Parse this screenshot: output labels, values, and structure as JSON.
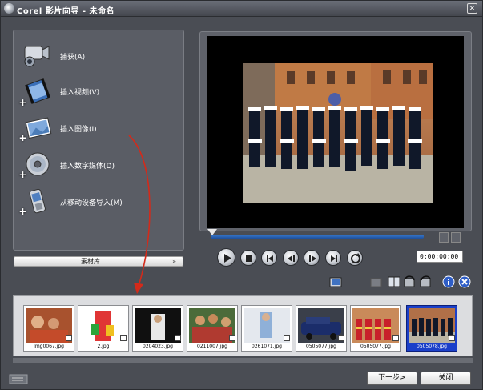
{
  "window": {
    "title": "Corel 影片向导 - 未命名",
    "close_glyph": "×"
  },
  "sidebar": {
    "items": [
      {
        "label": "捕获(A)",
        "icon": "camcorder-icon"
      },
      {
        "label": "插入视频(V)",
        "icon": "video-film-icon"
      },
      {
        "label": "插入图像(I)",
        "icon": "photo-icon"
      },
      {
        "label": "插入数字媒体(D)",
        "icon": "disc-icon"
      },
      {
        "label": "从移动设备导入(M)",
        "icon": "mobile-phone-icon"
      }
    ],
    "add_glyph": "+",
    "library_label": "素材库",
    "library_chevron": "»"
  },
  "player": {
    "timecode": "0:00:00:00"
  },
  "filmstrip": {
    "items": [
      {
        "caption": "Img0067.jpg",
        "selected": false
      },
      {
        "caption": "2.jpg",
        "selected": false
      },
      {
        "caption": "0204023.jpg",
        "selected": false
      },
      {
        "caption": "0211007.jpg",
        "selected": false
      },
      {
        "caption": "0261071.jpg",
        "selected": false
      },
      {
        "caption": "0505077.jpg",
        "selected": false
      },
      {
        "caption": "0505077.jpg",
        "selected": false
      },
      {
        "caption": "0505078.jpg",
        "selected": true
      }
    ]
  },
  "footer": {
    "next_label": "下一步>",
    "close_label": "关闭"
  },
  "colors": {
    "accent": "#1a3fc9",
    "track": "#3a7bd0",
    "arrow": "#d42a1a"
  }
}
